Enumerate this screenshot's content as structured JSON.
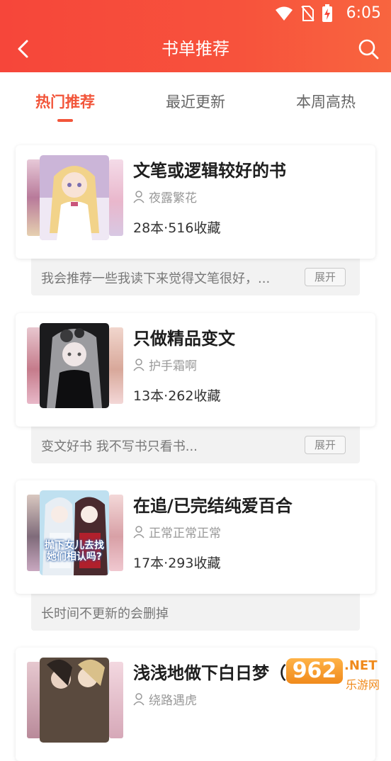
{
  "status": {
    "time": "6:05"
  },
  "header": {
    "title": "书单推荐"
  },
  "tabs": [
    {
      "label": "热门推荐",
      "active": true
    },
    {
      "label": "最近更新",
      "active": false
    },
    {
      "label": "本周高热",
      "active": false
    }
  ],
  "booklists": [
    {
      "title": "文笔或逻辑较好的书",
      "author": "夜露繁花",
      "stats": "28本·516收藏",
      "desc": "我会推荐一些我读下来觉得文笔很好，...",
      "expand": "展开"
    },
    {
      "title": "只做精品变文",
      "author": "护手霜啊",
      "stats": "13本·262收藏",
      "desc": "变文好书  我不写书只看书...",
      "expand": "展开"
    },
    {
      "title": "在追/已完结纯爱百合",
      "author": "正常正常正常",
      "stats": "17本·293收藏",
      "desc": "长时间不更新的会删掉",
      "expand": ""
    },
    {
      "title": "浅浅地做下白日梦（原",
      "author": "绕路遇虎",
      "stats": "",
      "desc": "",
      "expand": ""
    }
  ],
  "covers": [
    {
      "text": ""
    },
    {
      "text": ""
    },
    {
      "text": "抛下女儿去找她们相认吗?"
    },
    {
      "text": ""
    }
  ],
  "watermark": {
    "text": "962",
    "sub": "乐游网",
    "tld": ".NET"
  },
  "colors": {
    "accent": "#f2553a",
    "header": "#f6463a"
  }
}
